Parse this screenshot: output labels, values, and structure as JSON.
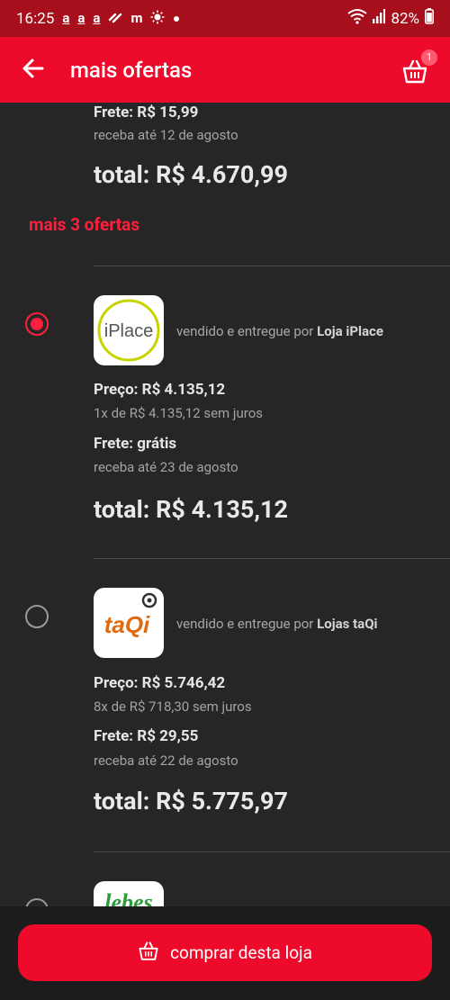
{
  "status_bar": {
    "time": "16:25",
    "notif_letters": [
      "a",
      "a",
      "a"
    ],
    "m_letter": "m",
    "battery": "82%"
  },
  "app_bar": {
    "title": "mais ofertas",
    "cart_count": "1"
  },
  "previous_offer": {
    "frete": "Frete: R$ 15,99",
    "delivery": "receba até 12 de agosto",
    "total": "total: R$ 4.670,99"
  },
  "more_offers_label": "mais 3 ofertas",
  "offers": [
    {
      "seller_prefix": "vendido e entregue por",
      "seller_name": "Loja iPlace",
      "logo_text": "iPlace",
      "selected": true,
      "price": "Preço: R$ 4.135,12",
      "installments": "1x de R$ 4.135,12 sem juros",
      "frete": "Frete: grátis",
      "delivery": "receba até 23 de agosto",
      "total": "total: R$ 4.135,12"
    },
    {
      "seller_prefix": "vendido e entregue por",
      "seller_name": "Lojas taQi",
      "logo_text": "taQi",
      "selected": false,
      "price": "Preço: R$ 5.746,42",
      "installments": "8x de R$ 718,30 sem juros",
      "frete": "Frete: R$ 29,55",
      "delivery": "receba até 22 de agosto",
      "total": "total: R$ 5.775,97"
    },
    {
      "logo_text": "lebes",
      "selected": false
    }
  ],
  "buy_button": {
    "label": "comprar desta loja"
  },
  "colors": {
    "brand_red": "#ed0a2a",
    "status_red": "#a70f1c",
    "background": "#262626"
  }
}
